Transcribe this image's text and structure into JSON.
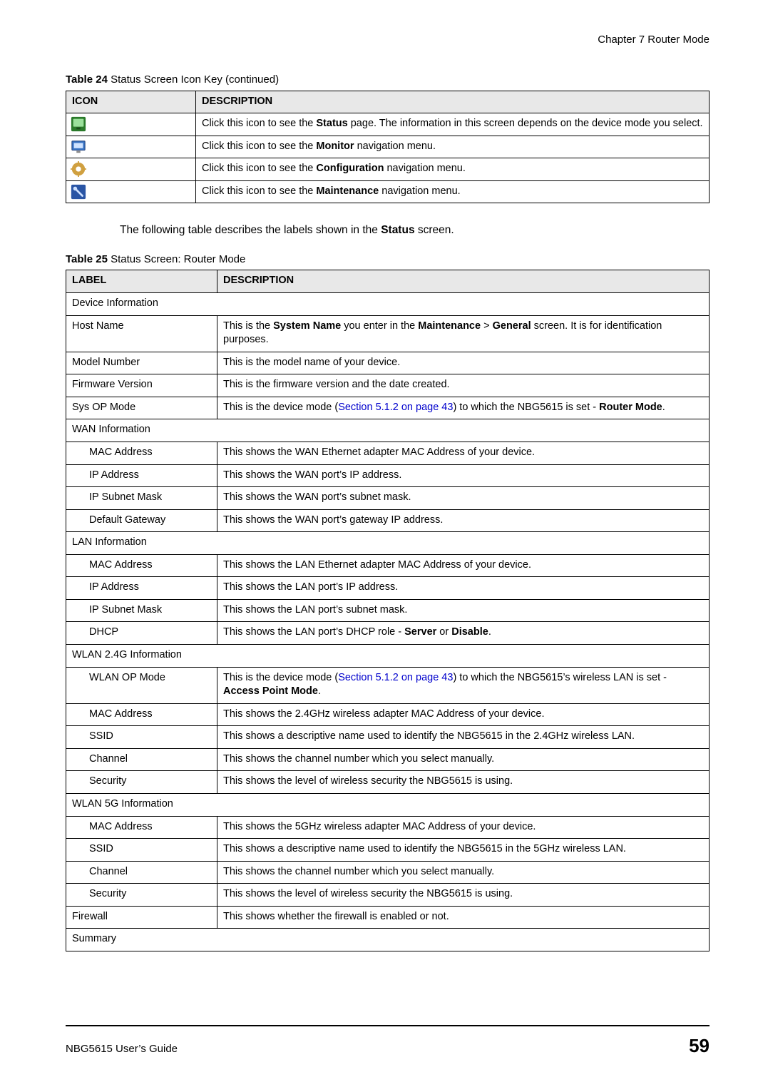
{
  "chapter_header": "Chapter 7 Router Mode",
  "table24": {
    "caption_prefix": "Table 24   ",
    "caption": "Status Screen Icon Key (continued)",
    "head_icon": "ICON",
    "head_desc": "DESCRIPTION",
    "rows": [
      {
        "icon_name": "status-icon",
        "desc_pre": "Click this icon to see the ",
        "bold": "Status",
        "desc_post": " page. The information in this screen depends on the device mode you select."
      },
      {
        "icon_name": "monitor-icon",
        "desc_pre": "Click this icon to see the ",
        "bold": "Monitor",
        "desc_post": " navigation menu."
      },
      {
        "icon_name": "configuration-icon",
        "desc_pre": "Click this icon to see the ",
        "bold": "Configuration",
        "desc_post": " navigation menu."
      },
      {
        "icon_name": "maintenance-icon",
        "desc_pre": "Click this icon to see the ",
        "bold": "Maintenance",
        "desc_post": " navigation menu."
      }
    ]
  },
  "body_text_pre": "The following table describes the labels shown in the ",
  "body_text_bold": "Status",
  "body_text_post": " screen.",
  "table25": {
    "caption_prefix": "Table 25   ",
    "caption": "Status Screen: Router Mode",
    "head_label": "LABEL",
    "head_desc": "DESCRIPTION",
    "rows": [
      {
        "label": "Device Information",
        "section": true
      },
      {
        "label": "Host Name",
        "desc_parts": [
          "This is the ",
          {
            "b": "System Name"
          },
          " you enter in the ",
          {
            "b": "Maintenance"
          },
          " > ",
          {
            "b": "General"
          },
          " screen. It is for identification purposes."
        ]
      },
      {
        "label": "Model Number",
        "desc": "This is the model name of your device."
      },
      {
        "label": "Firmware Version",
        "desc": "This is the firmware version and the date created."
      },
      {
        "label": "Sys OP Mode",
        "desc_parts": [
          "This is the device mode (",
          {
            "a": "Section 5.1.2 on page 43"
          },
          ") to which the NBG5615 is set - ",
          {
            "b": "Router Mode"
          },
          "."
        ]
      },
      {
        "label": "WAN Information",
        "section": true
      },
      {
        "label": "MAC Address",
        "indent": true,
        "desc": "This shows the WAN Ethernet adapter MAC Address of your device."
      },
      {
        "label": "IP Address",
        "indent": true,
        "desc": "This shows the WAN port’s IP address."
      },
      {
        "label": "IP Subnet Mask",
        "indent": true,
        "desc": "This shows the WAN port’s subnet mask."
      },
      {
        "label": "Default Gateway",
        "indent": true,
        "desc": "This shows the WAN port’s gateway IP address."
      },
      {
        "label": "LAN Information",
        "section": true
      },
      {
        "label": "MAC Address",
        "indent": true,
        "desc": "This shows the LAN Ethernet adapter MAC Address of your device."
      },
      {
        "label": "IP Address",
        "indent": true,
        "desc": "This shows the LAN port’s IP address."
      },
      {
        "label": "IP Subnet Mask",
        "indent": true,
        "desc": "This shows the LAN port’s subnet mask."
      },
      {
        "label": "DHCP",
        "indent": true,
        "desc_parts": [
          "This shows the LAN port’s DHCP role - ",
          {
            "b": "Server"
          },
          " or ",
          {
            "b": "Disable"
          },
          "."
        ]
      },
      {
        "label": "WLAN 2.4G Information",
        "section": true
      },
      {
        "label": "WLAN OP Mode",
        "indent": true,
        "desc_parts": [
          "This is the device mode (",
          {
            "a": "Section 5.1.2 on page 43"
          },
          ") to which the NBG5615’s wireless LAN is set - ",
          {
            "b": "Access Point Mode"
          },
          "."
        ]
      },
      {
        "label": "MAC Address",
        "indent": true,
        "desc": "This shows the 2.4GHz wireless adapter MAC Address of your device."
      },
      {
        "label": "SSID",
        "indent": true,
        "desc": "This shows a descriptive name used to identify the NBG5615 in the 2.4GHz wireless LAN."
      },
      {
        "label": "Channel",
        "indent": true,
        "desc": "This shows the channel number which you select manually."
      },
      {
        "label": "Security",
        "indent": true,
        "desc": "This shows the level of wireless security the NBG5615 is using."
      },
      {
        "label": "WLAN 5G Information",
        "section": true
      },
      {
        "label": "MAC Address",
        "indent": true,
        "desc": "This shows the 5GHz wireless adapter MAC Address of your device."
      },
      {
        "label": "SSID",
        "indent": true,
        "desc": "This shows a descriptive name used to identify the NBG5615 in the 5GHz wireless LAN."
      },
      {
        "label": "Channel",
        "indent": true,
        "desc": "This shows the channel number which you select manually."
      },
      {
        "label": "Security",
        "indent": true,
        "desc": "This shows the level of wireless security the NBG5615 is using."
      },
      {
        "label": "Firewall",
        "desc": "This shows whether the firewall is enabled or not."
      },
      {
        "label": "Summary",
        "section": true
      }
    ]
  },
  "footer": {
    "guide": "NBG5615 User’s Guide",
    "page": "59"
  },
  "icon_svgs": {
    "status-icon": "monitor-green",
    "monitor-icon": "monitor-blue",
    "configuration-icon": "gear",
    "maintenance-icon": "wrench"
  }
}
